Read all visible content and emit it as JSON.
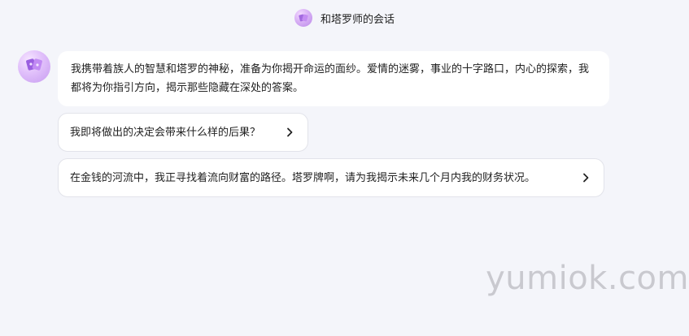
{
  "header": {
    "avatar_icon": "tarot-cards-icon",
    "title": "和塔罗师的会话"
  },
  "intro": {
    "avatar_icon": "tarot-cards-icon",
    "text": "我携带着族人的智慧和塔罗的神秘，准备为你揭开命运的面纱。爱情的迷雾，事业的十字路口，内心的探索，我都将为你指引方向，揭示那些隐藏在深处的答案。"
  },
  "suggestions": [
    {
      "text": "我即将做出的决定会带来什么样的后果？",
      "icon": "chevron-right-icon"
    },
    {
      "text": "在金钱的河流中，我正寻找着流向财富的路径。塔罗牌啊，请为我揭示未来几个月内我的财务状况。",
      "icon": "chevron-right-icon"
    }
  ],
  "watermark": "yumiok.com",
  "colors": {
    "background": "#f4f5fa",
    "bubble": "#ffffff",
    "avatar_accent": "#b987e8"
  }
}
